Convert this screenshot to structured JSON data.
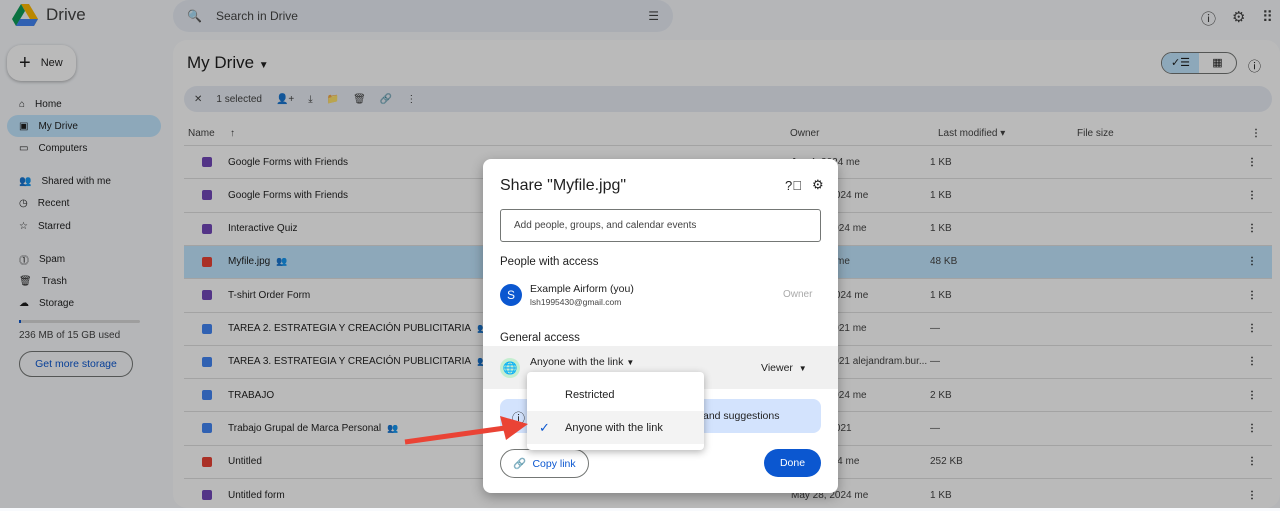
{
  "app": {
    "name": "Drive",
    "search_placeholder": "Search in Drive"
  },
  "sidebar": {
    "new_label": "New",
    "items": [
      {
        "label": "Home"
      },
      {
        "label": "My Drive"
      },
      {
        "label": "Computers"
      },
      {
        "label": "Shared with me"
      },
      {
        "label": "Recent"
      },
      {
        "label": "Starred"
      },
      {
        "label": "Spam"
      },
      {
        "label": "Trash"
      },
      {
        "label": "Storage"
      }
    ],
    "storage_text": "236 MB of 15 GB used",
    "storage_fraction": 0.016,
    "get_storage": "Get more storage"
  },
  "main": {
    "title": "My Drive",
    "selected_count": "1 selected",
    "columns": {
      "name": "Name",
      "owner": "Owner",
      "modified": "Last modified",
      "size": "File size"
    },
    "rows": [
      {
        "name": "Google Forms with Friends",
        "type": "form",
        "modified": "Jun 4, 2024 me",
        "size": "1 KB",
        "shared": false
      },
      {
        "name": "Google Forms with Friends",
        "type": "form",
        "modified": "May 29, 2024 me",
        "size": "1 KB",
        "shared": false
      },
      {
        "name": "Interactive Quiz",
        "type": "form",
        "modified": "Mar 12, 2024 me",
        "size": "1 KB",
        "shared": false
      },
      {
        "name": "Myfile.jpg",
        "type": "image",
        "modified": "10:57 AM me",
        "size": "48 KB",
        "shared": true,
        "selected": true
      },
      {
        "name": "T-shirt Order Form",
        "type": "form",
        "modified": "May 29, 2024 me",
        "size": "1 KB",
        "shared": false
      },
      {
        "name": "TAREA 2. ESTRATEGIA Y CREACIÓN PUBLICITARIA",
        "type": "doc",
        "modified": "Feb 12, 2021 me",
        "size": "—",
        "shared": true
      },
      {
        "name": "TAREA 3. ESTRATEGIA Y CREACIÓN PUBLICITARIA",
        "type": "doc",
        "modified": "Feb 13, 2021 alejandram.bur...",
        "size": "—",
        "shared": true
      },
      {
        "name": "TRABAJO",
        "type": "doc",
        "modified": "Mar 12, 2024 me",
        "size": "2 KB",
        "shared": false
      },
      {
        "name": "Trabajo Grupal de Marca Personal",
        "type": "doc",
        "modified": "May 10, 2021",
        "size": "—",
        "shared": true
      },
      {
        "name": "Untitled",
        "type": "image",
        "modified": "Apr 2, 2024 me",
        "size": "252 KB",
        "shared": false
      },
      {
        "name": "Untitled form",
        "type": "form",
        "modified": "May 28, 2024 me",
        "size": "1 KB",
        "shared": false
      }
    ]
  },
  "dialog": {
    "title": "Share \"Myfile.jpg\"",
    "add_placeholder": "Add people, groups, and calendar events",
    "people_heading": "People with access",
    "person": {
      "initial": "S",
      "name": "Example Airform (you)",
      "email": "lsh1995430@gmail.com",
      "role": "Owner"
    },
    "general_heading": "General access",
    "access_value": "Anyone with the link",
    "role_value": "Viewer",
    "info_text": "and suggestions",
    "copy_link": "Copy link",
    "done": "Done"
  },
  "dropdown": {
    "options": [
      {
        "label": "Restricted",
        "selected": false
      },
      {
        "label": "Anyone with the link",
        "selected": true
      }
    ]
  },
  "colors": {
    "form": "#7248b9",
    "doc": "#4285f4",
    "image": "#ea4335",
    "accent": "#0b57d0",
    "arrow": "#ea4335"
  }
}
